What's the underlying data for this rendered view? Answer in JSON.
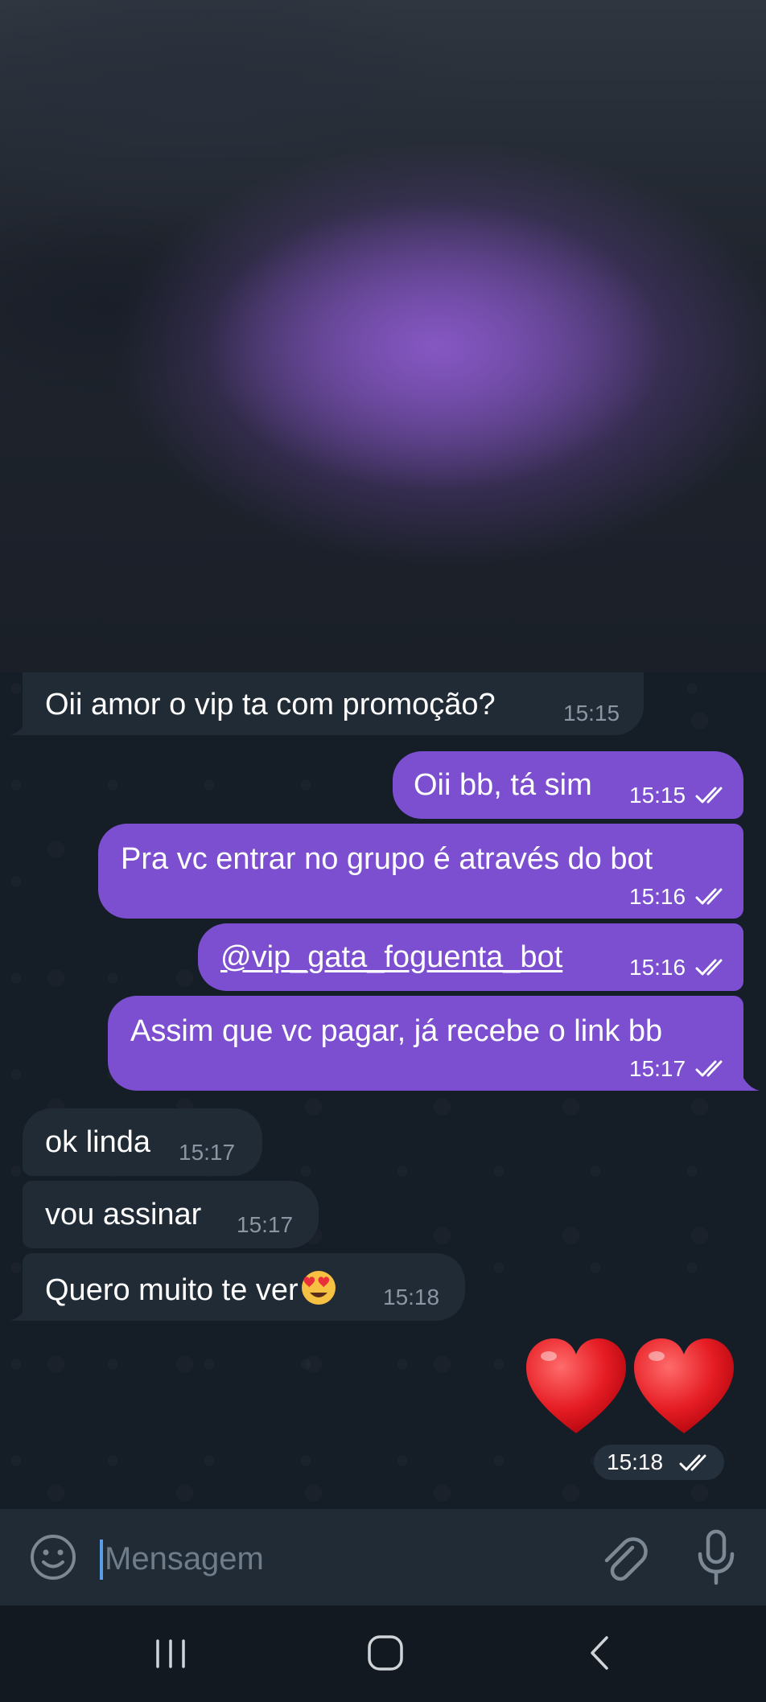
{
  "messages": [
    {
      "id": "m1",
      "direction": "in",
      "text": "Oii amor o vip ta com promoção?",
      "time": "15:15"
    },
    {
      "id": "m2",
      "direction": "out",
      "text": "Oii bb, tá sim",
      "time": "15:15",
      "status": "read"
    },
    {
      "id": "m3",
      "direction": "out",
      "text": "Pra vc entrar no grupo é  através do bot",
      "time": "15:16",
      "status": "read"
    },
    {
      "id": "m4",
      "direction": "out",
      "text": "@vip_gata_foguenta_bot",
      "time": "15:16",
      "status": "read",
      "is_mention": true
    },
    {
      "id": "m5",
      "direction": "out",
      "text": "Assim que vc pagar, já recebe o link bb",
      "time": "15:17",
      "status": "read"
    },
    {
      "id": "m6",
      "direction": "in",
      "text": "ok linda",
      "time": "15:17"
    },
    {
      "id": "m7",
      "direction": "in",
      "text": "vou assinar",
      "time": "15:17"
    },
    {
      "id": "m8",
      "direction": "in",
      "text": "Quero muito te ver",
      "emoji": "heart-eyes-emoji",
      "time": "15:18"
    },
    {
      "id": "m9",
      "direction": "out",
      "type": "sticker",
      "emoji": "two-red-hearts",
      "time": "15:18",
      "status": "read"
    }
  ],
  "composer": {
    "placeholder": "Mensagem",
    "emoji_icon": "smiley-icon",
    "attach_icon": "paperclip-icon",
    "mic_icon": "microphone-icon"
  },
  "system_nav": {
    "recents_icon": "recents-icon",
    "home_icon": "home-icon",
    "back_icon": "back-icon"
  },
  "colors": {
    "outgoing_bubble": "#7b4fcf",
    "incoming_bubble": "#212b36",
    "chat_background": "#151d27",
    "input_bar": "#212b36",
    "cursor": "#5a9ee8"
  }
}
